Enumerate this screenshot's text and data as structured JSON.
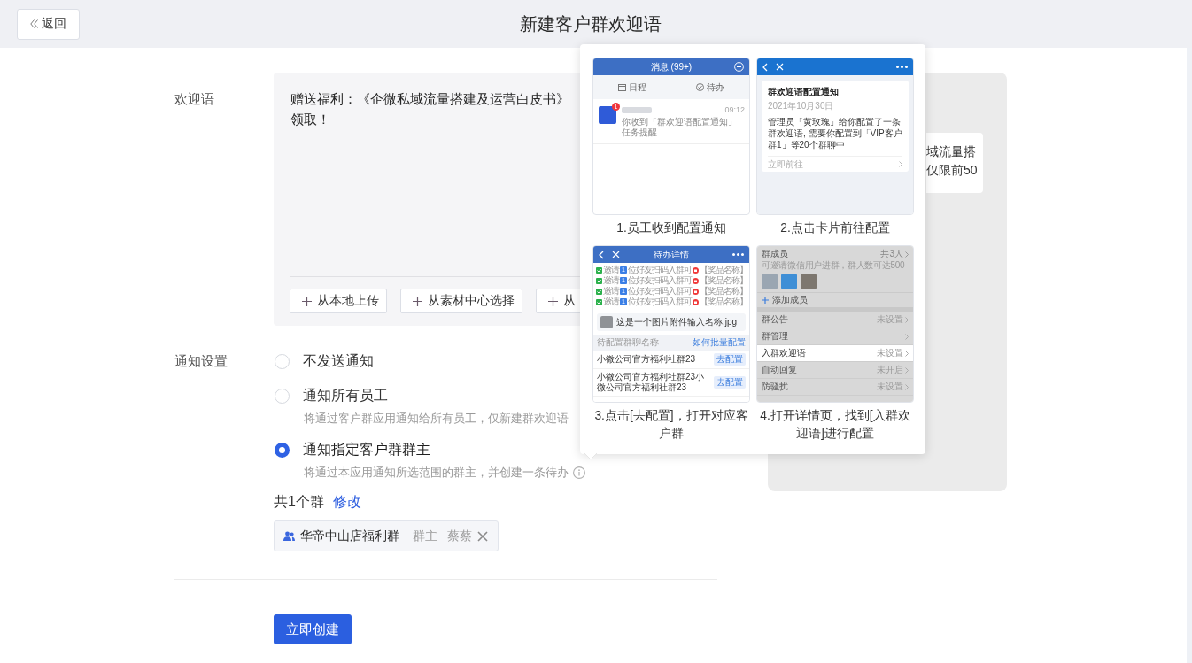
{
  "header": {
    "back": "返回",
    "title": "新建客户群欢迎语"
  },
  "welcome": {
    "label": "欢迎语",
    "lines": [
      "赠送福利：《企微私域流量搭建及运营白皮书》",
      "领取！"
    ],
    "actions": [
      "从本地上传",
      "从素材中心选择",
      "从"
    ]
  },
  "notify": {
    "label": "通知设置",
    "options": [
      {
        "label": "不发送通知",
        "selected": false,
        "info": false
      },
      {
        "label": "通知所有员工",
        "selected": false,
        "description": "将通过客户群应用通知给所有员工，仅新建群欢迎语",
        "info": false
      },
      {
        "label": "通知指定客户群群主",
        "selected": true,
        "description": "将通过本应用通知所选范围的群主，并创建一条待办",
        "info": true
      }
    ],
    "summary": "共1个群",
    "edit": "修改",
    "groups": [
      {
        "name": "华帝中山店福利群",
        "role": "群主",
        "owner": "蔡蔡"
      }
    ]
  },
  "submit": "立即创建",
  "preview": {
    "lines": [
      "域流量搭",
      "仅限前50"
    ]
  },
  "guide": {
    "steps": [
      {
        "caption": "1.员工收到配置通知",
        "screen": {
          "kind": "messages",
          "title": "消息 (99+)",
          "tabs": [
            "日程",
            "待办"
          ],
          "items": [
            {
              "redacted": true,
              "badge": "1",
              "time": "09:12",
              "text": "你收到「群欢迎语配置通知」任务提醒"
            }
          ]
        }
      },
      {
        "caption": "2.点击卡片前往配置",
        "screen": {
          "kind": "notice",
          "card": {
            "title": "群欢迎语配置通知",
            "date": "2021年10月30日",
            "body": "管理员「黄玫瑰」给你配置了一条群欢迎语, 需要你配置到「VIP客户群1」等20个群聊中",
            "action": "立即前往"
          }
        }
      },
      {
        "caption": "3.点击[去配置]，打开对应客户群",
        "screen": {
          "kind": "todo",
          "title": "待办详情",
          "tasks": [
            {
              "checked": true,
              "verb": "邀请",
              "count": "1",
              "text": "位好友扫码入群可",
              "reward": "【奖品名称】"
            },
            {
              "checked": true,
              "verb": "邀请",
              "count": "1",
              "text": "位好友扫码入群可",
              "reward": "【奖品名称】"
            },
            {
              "checked": true,
              "verb": "邀请",
              "count": "1",
              "text": "位好友扫码入群可",
              "reward": "【奖品名称】"
            },
            {
              "checked": true,
              "verb": "邀请",
              "count": "1",
              "text": "位好友扫码入群可",
              "reward": "【奖品名称】"
            }
          ],
          "attachment": "这是一个图片附件输入名称.jpg",
          "section": "待配置群聊名称",
          "section_link": "如何批量配置",
          "groups": [
            {
              "name": "小微公司官方福利社群23",
              "action": "去配置"
            },
            {
              "name": "小微公司官方福利社群23小微公司官方福利社群23",
              "action": "去配置"
            }
          ]
        }
      },
      {
        "caption": "4.打开详情页，找到[入群欢迎语]进行配置",
        "screen": {
          "kind": "group_settings",
          "members_title": "群成员",
          "members_count": "共3人",
          "members_hint": "可邀请微信用户进群，群人数可达500",
          "members": [
            {
              "kind": "photo"
            },
            {
              "kind": "photo"
            },
            {
              "kind": "photo"
            }
          ],
          "add_member": "添加成员",
          "rows": [
            {
              "label": "群公告",
              "value": "未设置",
              "selected": false
            },
            {
              "label": "群管理",
              "selected": false
            },
            {
              "label": "入群欢迎语",
              "value": "未设置",
              "selected": true
            },
            {
              "label": "自动回复",
              "value": "未开启",
              "selected": false
            },
            {
              "label": "防骚扰",
              "value": "未设置",
              "selected": false
            }
          ]
        }
      }
    ]
  }
}
